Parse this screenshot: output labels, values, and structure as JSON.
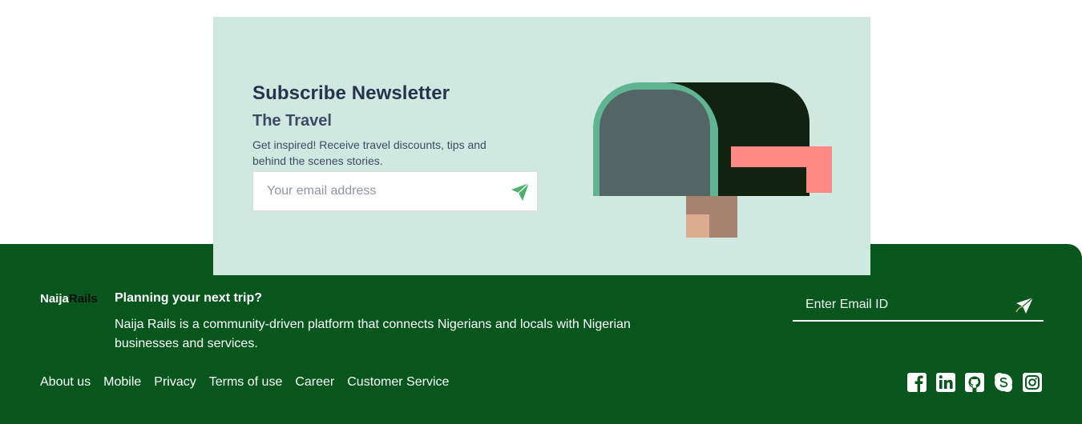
{
  "newsletter": {
    "title": "Subscribe Newsletter",
    "subtitle": "The Travel",
    "description": "Get inspired! Receive travel discounts, tips and behind the scenes stories.",
    "email_placeholder": "Your email address",
    "send_icon": "paper-plane-icon",
    "illustration": "mailbox-illustration"
  },
  "footer": {
    "brand_part1": "Naija",
    "brand_part2": "Rails",
    "heading": "Planning your next trip?",
    "description": "Naija Rails is a community-driven platform that connects Nigerians and locals with Nigerian businesses and services.",
    "email_placeholder": "Enter Email ID",
    "links": [
      "About us",
      "Mobile",
      "Privacy",
      "Terms of use",
      "Career",
      "Customer Service"
    ],
    "social_icons": [
      "facebook-icon",
      "linkedin-icon",
      "github-icon",
      "skype-icon",
      "instagram-icon"
    ]
  },
  "colors": {
    "footer_bg": "#07561d",
    "card_bg": "#cfe9e0",
    "title_text": "#26334d",
    "send_green": "#4caf6f",
    "mailbox_dark": "#122211",
    "mailbox_rim": "#5fb592",
    "mailbox_door": "#546566",
    "flag": "#ff8a85",
    "post": "#a88270"
  }
}
